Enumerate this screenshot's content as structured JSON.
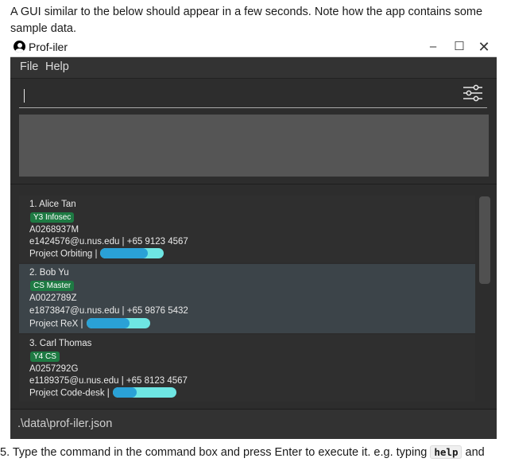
{
  "doc": {
    "line1": "A GUI similar to the below should appear in a few seconds. Note how the app contains some",
    "line2": "sample data.",
    "bottom_prefix": "5. Type the command in the command box and press Enter to execute it. e.g. typing ",
    "bottom_code": "help",
    "bottom_suffix": " and"
  },
  "window": {
    "title": "Prof-iler",
    "controls": {
      "minimize": "–",
      "maximize": "☐",
      "close": "✕"
    }
  },
  "menu": {
    "file": "File",
    "help": "Help"
  },
  "command_box": {
    "value": ""
  },
  "persons": [
    {
      "index_name": "1. Alice Tan",
      "tag": "Y3 Infosec",
      "id": "A0268937M",
      "contact": "e1424576@u.nus.edu | +65 9123 4567",
      "project": "Project Orbiting |",
      "progress": 0.74
    },
    {
      "index_name": "2. Bob Yu",
      "tag": "CS Master",
      "id": "A0022789Z",
      "contact": "e1873847@u.nus.edu | +65 9876 5432",
      "project": "Project ReX |",
      "progress": 0.68
    },
    {
      "index_name": "3. Carl Thomas",
      "tag": "Y4 CS",
      "id": "A0257292G",
      "contact": "e1189375@u.nus.edu | +65 8123 4567",
      "project": "Project Code-desk |",
      "progress": 0.38
    }
  ],
  "status": {
    "file_path": ".\\data\\prof-iler.json"
  },
  "colors": {
    "tag": "#1e7a43",
    "progress_fill": "#2aa1d6",
    "progress_track": "#6ee6e3",
    "selected_card": "#3c4449"
  },
  "icons": {
    "app": "person-circle-icon",
    "filter": "sliders-icon"
  }
}
